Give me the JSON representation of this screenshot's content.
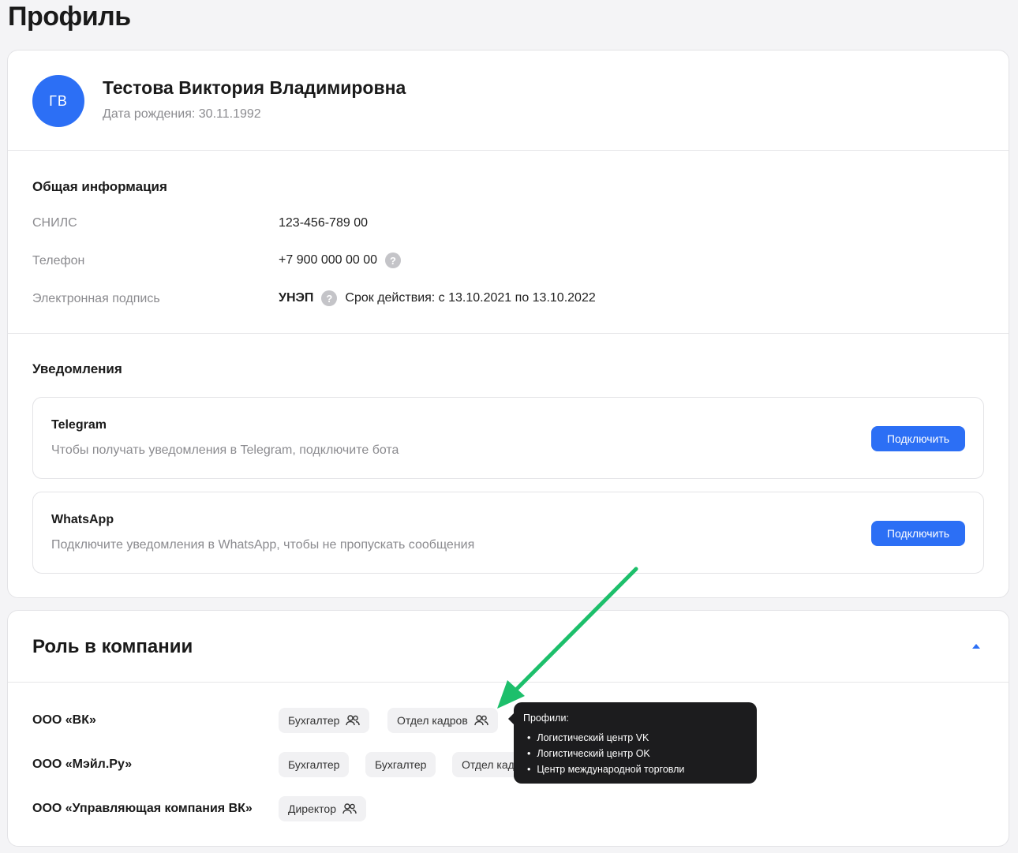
{
  "page": {
    "title": "Профиль"
  },
  "profile": {
    "initials": "ГВ",
    "full_name": "Тестова Виктория Владимировна",
    "birth_label": "Дата рождения:",
    "birth_date": "30.11.1992"
  },
  "general": {
    "title": "Общая информация",
    "snils_label": "СНИЛС",
    "snils_value": "123-456-789 00",
    "phone_label": "Телефон",
    "phone_value": "+7 900 000 00 00",
    "signature_label": "Электронная подпись",
    "signature_type": "УНЭП",
    "signature_validity": "Срок действия: с 13.10.2021 по 13.10.2022"
  },
  "notifications": {
    "title": "Уведомления",
    "items": [
      {
        "name": "Telegram",
        "description": "Чтобы получать уведомления в Telegram, подключите бота",
        "button": "Подключить"
      },
      {
        "name": "WhatsApp",
        "description": "Подключите уведомления в WhatsApp, чтобы не пропускать сообщения",
        "button": "Подключить"
      }
    ]
  },
  "roles": {
    "title": "Роль в компании",
    "companies": [
      {
        "name": "ООО «ВК»",
        "chips": [
          "Бухгалтер",
          "Отдел кадров"
        ]
      },
      {
        "name": "ООО «Мэйл.Ру»",
        "chips": [
          "Бухгалтер",
          "Бухгалтер",
          "Отдел кадров"
        ]
      },
      {
        "name": "ООО «Управляющая компания ВК»",
        "chips": [
          "Директор"
        ]
      }
    ]
  },
  "tooltip": {
    "title": "Профили:",
    "items": [
      "Логистический центр VK",
      "Логистический центр OK",
      "Центр международной торговли"
    ]
  },
  "colors": {
    "accent": "#2c6ff5",
    "annotation_arrow": "#1dbf6b",
    "tooltip_bg": "#1c1c1e"
  },
  "icons": {
    "people": "people-icon",
    "help": "question-icon",
    "collapse": "chevron-up-icon"
  }
}
